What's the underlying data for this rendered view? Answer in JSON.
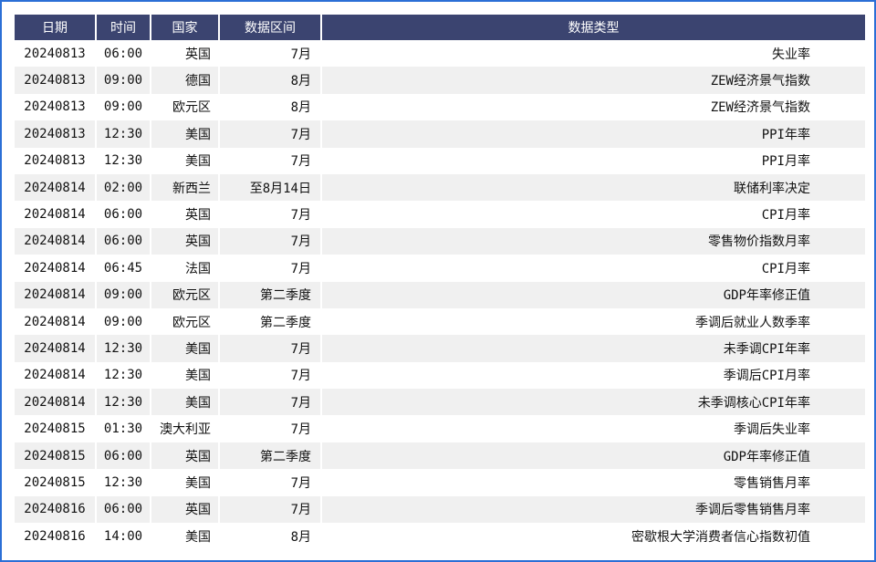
{
  "table": {
    "headers": [
      "日期",
      "时间",
      "国家",
      "数据区间",
      "数据类型"
    ],
    "rows": [
      {
        "date": "20240813",
        "time": "06:00",
        "country": "英国",
        "period": "7月",
        "type": "失业率"
      },
      {
        "date": "20240813",
        "time": "09:00",
        "country": "德国",
        "period": "8月",
        "type": "ZEW经济景气指数"
      },
      {
        "date": "20240813",
        "time": "09:00",
        "country": "欧元区",
        "period": "8月",
        "type": "ZEW经济景气指数"
      },
      {
        "date": "20240813",
        "time": "12:30",
        "country": "美国",
        "period": "7月",
        "type": "PPI年率"
      },
      {
        "date": "20240813",
        "time": "12:30",
        "country": "美国",
        "period": "7月",
        "type": "PPI月率"
      },
      {
        "date": "20240814",
        "time": "02:00",
        "country": "新西兰",
        "period": "至8月14日",
        "type": "联储利率决定"
      },
      {
        "date": "20240814",
        "time": "06:00",
        "country": "英国",
        "period": "7月",
        "type": "CPI月率"
      },
      {
        "date": "20240814",
        "time": "06:00",
        "country": "英国",
        "period": "7月",
        "type": "零售物价指数月率"
      },
      {
        "date": "20240814",
        "time": "06:45",
        "country": "法国",
        "period": "7月",
        "type": "CPI月率"
      },
      {
        "date": "20240814",
        "time": "09:00",
        "country": "欧元区",
        "period": "第二季度",
        "type": "GDP年率修正值"
      },
      {
        "date": "20240814",
        "time": "09:00",
        "country": "欧元区",
        "period": "第二季度",
        "type": "季调后就业人数季率"
      },
      {
        "date": "20240814",
        "time": "12:30",
        "country": "美国",
        "period": "7月",
        "type": "未季调CPI年率"
      },
      {
        "date": "20240814",
        "time": "12:30",
        "country": "美国",
        "period": "7月",
        "type": "季调后CPI月率"
      },
      {
        "date": "20240814",
        "time": "12:30",
        "country": "美国",
        "period": "7月",
        "type": "未季调核心CPI年率"
      },
      {
        "date": "20240815",
        "time": "01:30",
        "country": "澳大利亚",
        "period": "7月",
        "type": "季调后失业率"
      },
      {
        "date": "20240815",
        "time": "06:00",
        "country": "英国",
        "period": "第二季度",
        "type": "GDP年率修正值"
      },
      {
        "date": "20240815",
        "time": "12:30",
        "country": "美国",
        "period": "7月",
        "type": "零售销售月率"
      },
      {
        "date": "20240816",
        "time": "06:00",
        "country": "英国",
        "period": "7月",
        "type": "季调后零售销售月率"
      },
      {
        "date": "20240816",
        "time": "14:00",
        "country": "美国",
        "period": "8月",
        "type": "密歇根大学消费者信心指数初值"
      }
    ]
  },
  "colors": {
    "header_bg": "#3b4470",
    "header_text": "#ffffff",
    "stripe": "#f0f0f0",
    "frame_border": "#2b6fd6"
  }
}
